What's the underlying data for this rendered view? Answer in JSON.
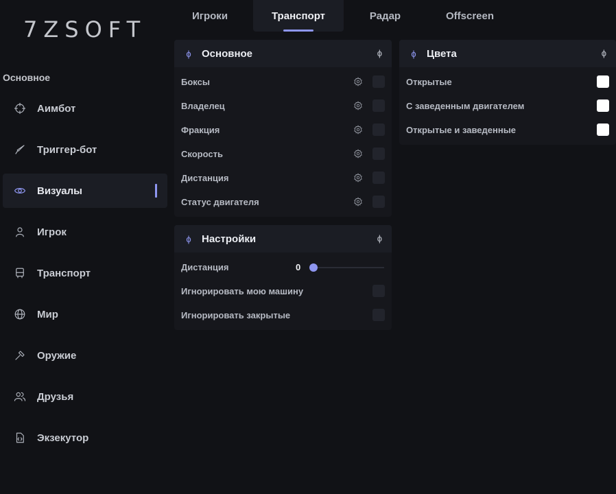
{
  "app": {
    "logo": "7ZSOFT"
  },
  "sidebar": {
    "section_title": "Основное",
    "items": [
      {
        "label": "Аимбот",
        "icon": "crosshair-icon"
      },
      {
        "label": "Триггер-бот",
        "icon": "knife-icon"
      },
      {
        "label": "Визуалы",
        "icon": "eye-icon",
        "active": true
      },
      {
        "label": "Игрок",
        "icon": "user-icon"
      },
      {
        "label": "Транспорт",
        "icon": "bus-icon"
      },
      {
        "label": "Мир",
        "icon": "globe-icon"
      },
      {
        "label": "Оружие",
        "icon": "hammer-icon"
      },
      {
        "label": "Друзья",
        "icon": "users-icon"
      },
      {
        "label": "Экзекутор",
        "icon": "code-file-icon"
      }
    ]
  },
  "tabs": [
    {
      "label": "Игроки"
    },
    {
      "label": "Транспорт",
      "active": true
    },
    {
      "label": "Радар"
    },
    {
      "label": "Offscreen"
    }
  ],
  "panels": {
    "main": {
      "title": "Основное",
      "rows": [
        {
          "label": "Боксы",
          "checked": false
        },
        {
          "label": "Владелец",
          "checked": false
        },
        {
          "label": "Фракция",
          "checked": false
        },
        {
          "label": "Скорость",
          "checked": false
        },
        {
          "label": "Дистанция",
          "checked": false
        },
        {
          "label": "Статус двигателя",
          "checked": false
        }
      ]
    },
    "settings": {
      "title": "Настройки",
      "distance_label": "Дистанция",
      "distance_value": "0",
      "rows": [
        {
          "label": "Игнорировать мою машину",
          "checked": false
        },
        {
          "label": "Игнорировать закрытые",
          "checked": false
        }
      ]
    },
    "colors": {
      "title": "Цвета",
      "rows": [
        {
          "label": "Открытые",
          "color": "#ffffff"
        },
        {
          "label": "С заведенным двигателем",
          "color": "#ffffff"
        },
        {
          "label": "Открытые и заведенные",
          "color": "#ffffff"
        }
      ]
    }
  },
  "theme": {
    "accent": "#8e96f0",
    "background": "#111216",
    "panel": "#16171c"
  }
}
